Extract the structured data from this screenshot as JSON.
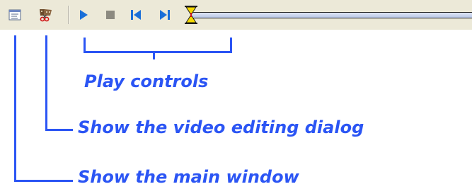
{
  "toolbar": {
    "buttons": [
      {
        "name": "main-window-icon"
      },
      {
        "name": "video-editing-icon"
      },
      {
        "name": "play-icon"
      },
      {
        "name": "stop-icon"
      },
      {
        "name": "skip-to-start-icon"
      },
      {
        "name": "skip-to-end-icon"
      }
    ],
    "timeline": {
      "position": 0
    }
  },
  "callouts": {
    "play_controls": "Play controls",
    "video_editing": "Show the video editing dialog",
    "main_window": "Show the main window"
  },
  "colors": {
    "annotation": "#2b55f4",
    "toolbar_bg": "#ece9d8",
    "control_blue": "#1a6fd8",
    "stop_gray": "#8c8a80"
  }
}
